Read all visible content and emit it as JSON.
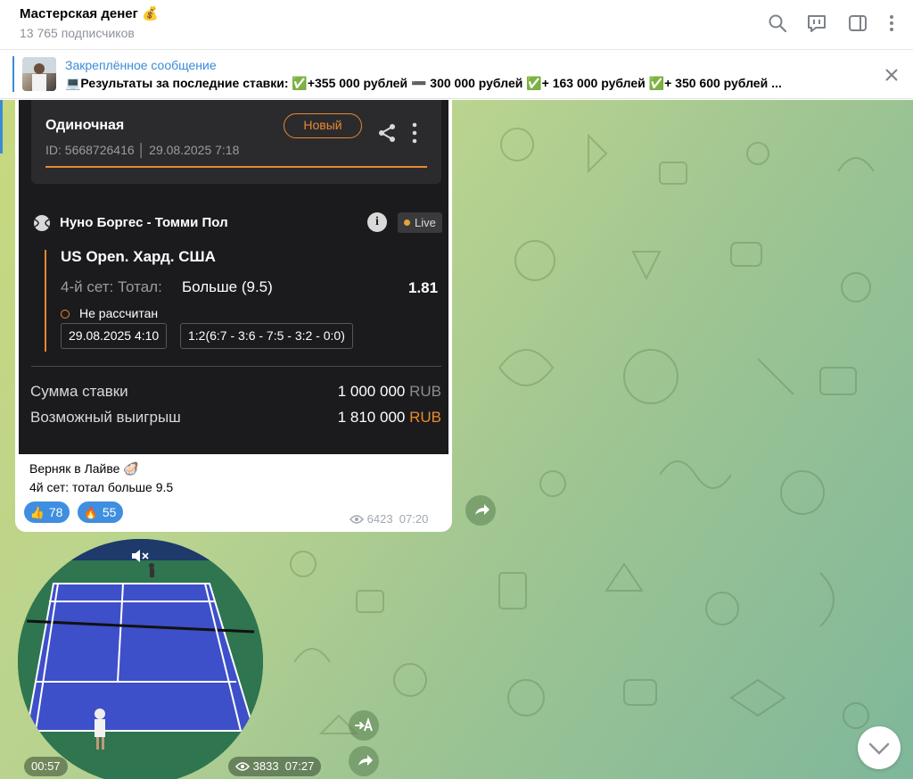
{
  "header": {
    "title": "Мастерская денег 💰",
    "subscribers": "13 765 подписчиков",
    "icons": [
      "search-icon",
      "live-chat-icon",
      "sidebar-icon",
      "more-icon"
    ]
  },
  "pinned": {
    "title": "Закреплённое сообщение",
    "text": "💻Результаты за последние ставки: ✅+355 000 рублей ➖ 300 000 рублей ✅+ 163 000 рублей ✅+ 350 600 рублей ..."
  },
  "bet": {
    "type": "Одиночная",
    "badge": "Новый",
    "id_line": "ID: 5668726416 │ 29.08.2025 7:18",
    "match": "Нуно Боргес - Томми Пол",
    "live": "Live",
    "tournament": "US Open. Хард. США",
    "market": "4-й сет: Тотал:",
    "pick": "Больше (9.5)",
    "odds": "1.81",
    "status": "Не рассчитан",
    "date_chip": "29.08.2025 4:10",
    "score_chip": "1:2(6:7 - 3:6 - 7:5 - 3:2 - 0:0)",
    "stake_label": "Сумма ставки",
    "stake_value": "1 000 000",
    "stake_currency": "RUB",
    "win_label": "Возможный выигрыш",
    "win_value": "1 810 000",
    "win_currency": "RUB"
  },
  "message": {
    "line1": "Верняк в Лайве 🦪",
    "line2": "4й сет: тотал больше 9.5",
    "reactions": [
      {
        "emoji": "👍",
        "count": "78"
      },
      {
        "emoji": "🔥",
        "count": "55"
      }
    ],
    "views": "6423",
    "time": "07:20"
  },
  "video": {
    "duration": "00:57",
    "views": "3833",
    "time": "07:27"
  },
  "colors": {
    "accent": "#3a8bd7",
    "orange": "#e8882f",
    "card_bg": "#1b1b1d"
  }
}
